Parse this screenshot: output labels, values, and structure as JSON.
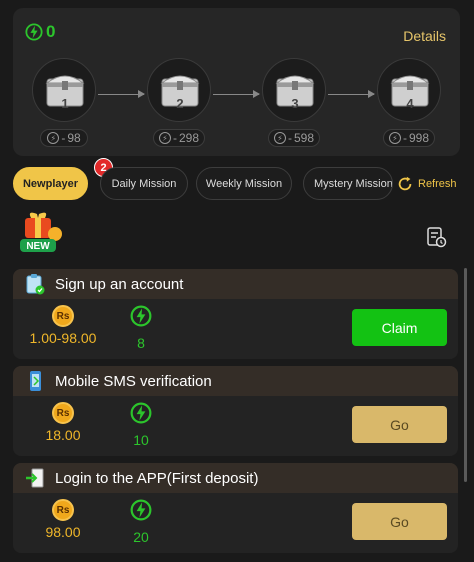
{
  "energy_balance": "0",
  "details_label": "Details",
  "chests": [
    {
      "number": "1",
      "cost": "98"
    },
    {
      "number": "2",
      "cost": "298"
    },
    {
      "number": "3",
      "cost": "598"
    },
    {
      "number": "4",
      "cost": "998"
    }
  ],
  "tabs": [
    {
      "label": "Newplayer",
      "badge": "2",
      "active": true
    },
    {
      "label": "Daily Mission"
    },
    {
      "label": "Weekly Mission"
    },
    {
      "label": "Mystery Mission"
    }
  ],
  "refresh_label": "Refresh",
  "new_label": "NEW",
  "tasks": [
    {
      "title": "Sign up an account",
      "cash": "1.00-98.00",
      "energy": "8",
      "button": "Claim",
      "button_state": "claim"
    },
    {
      "title": "Mobile SMS verification",
      "cash": "18.00",
      "energy": "10",
      "button": "Go",
      "button_state": "go"
    },
    {
      "title": "Login to the APP(First deposit)",
      "cash": "98.00",
      "energy": "20",
      "button": "Go",
      "button_state": "go"
    }
  ],
  "currency_symbol": "Rs",
  "colors": {
    "accent_gold": "#f0c548",
    "energy_green": "#2cc52c",
    "claim_green": "#13c213",
    "badge_red": "#e22a2a"
  }
}
